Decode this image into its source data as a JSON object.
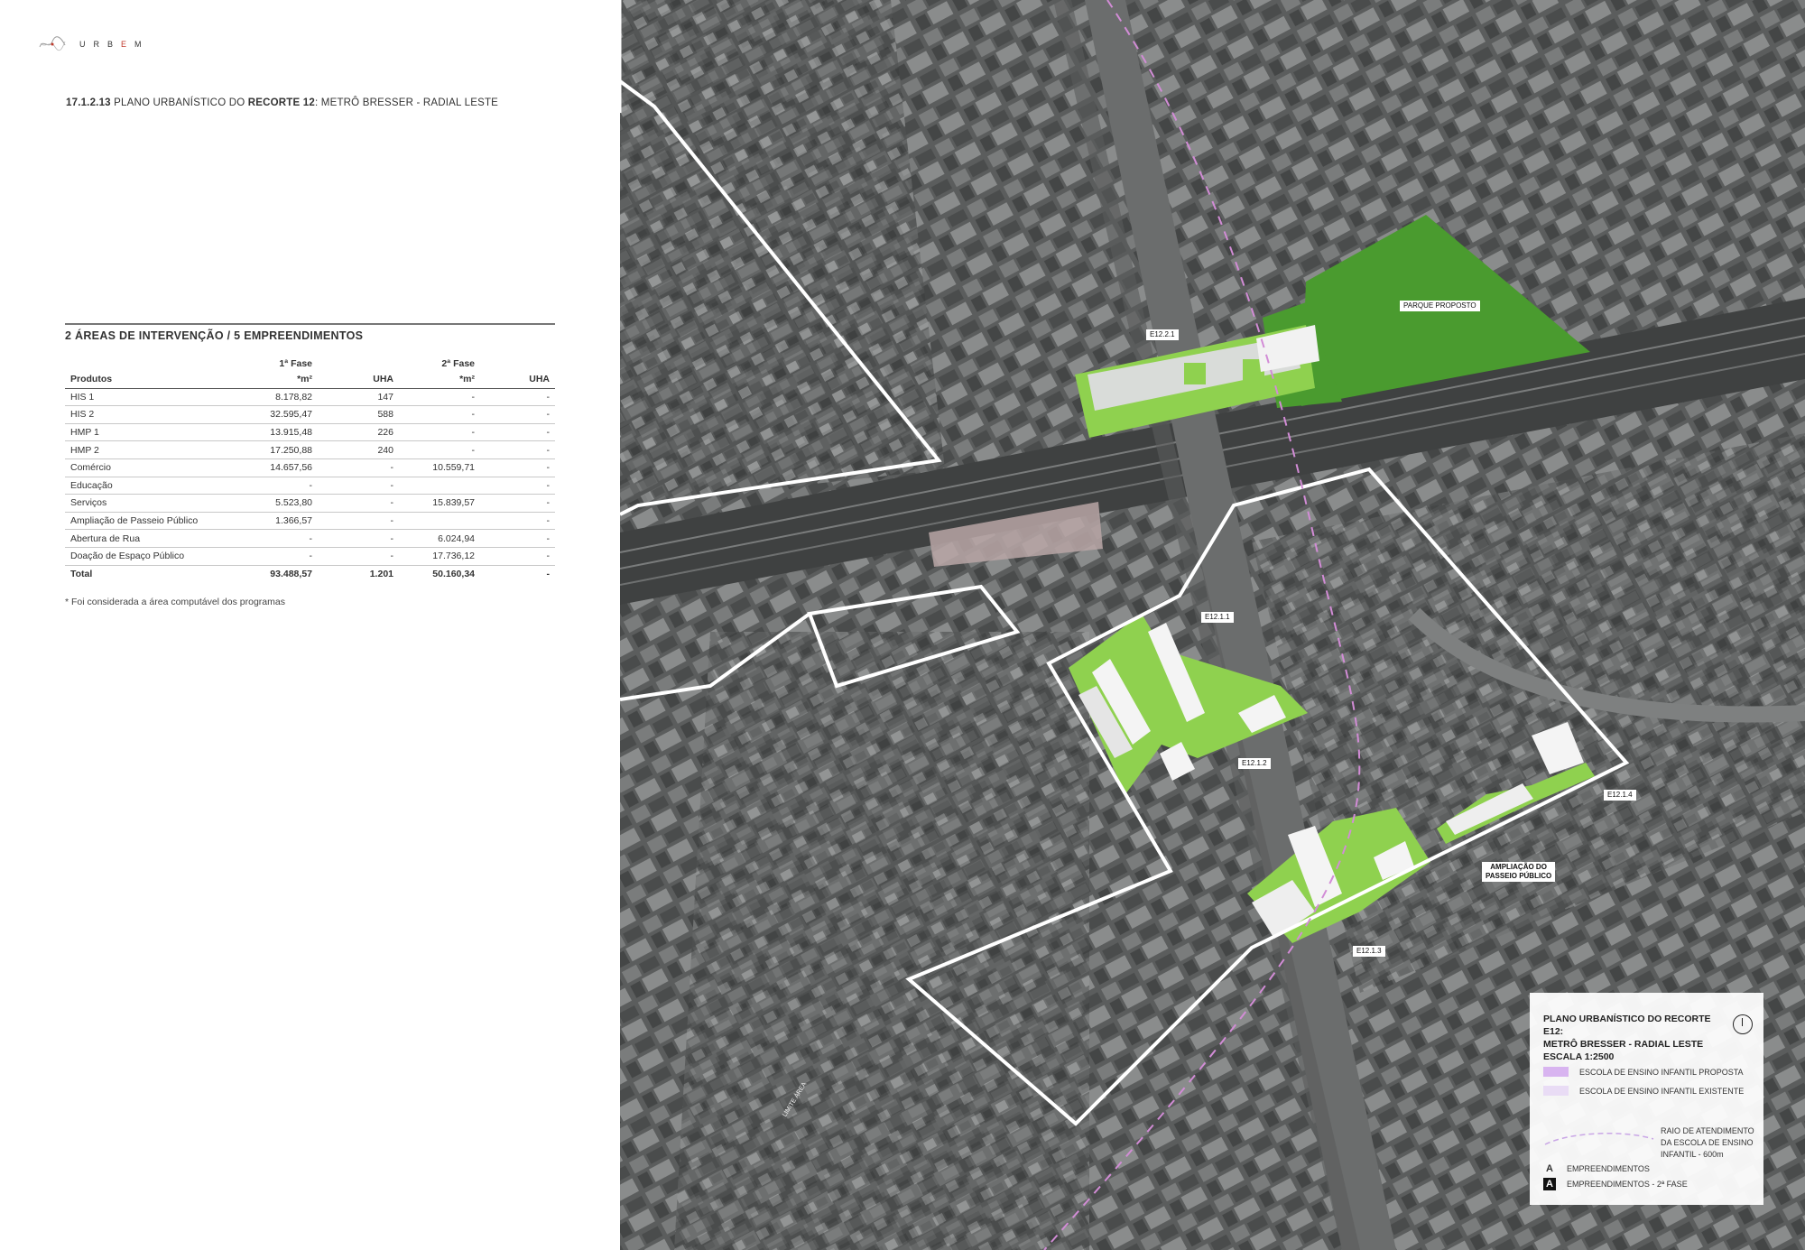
{
  "brand": {
    "logo_text_pre": "URB",
    "logo_text_hl": "E",
    "logo_text_post": "M"
  },
  "heading": {
    "number": "17.1.2.13",
    "text_a": " PLANO URBANÍSTICO DO ",
    "bold": "RECORTE 12",
    "text_b": ": METRÔ BRESSER - RADIAL LESTE"
  },
  "section": {
    "title": "2 ÁREAS DE INTERVENÇÃO / 5 EMPREENDIMENTOS"
  },
  "table": {
    "phase1": "1ª Fase",
    "phase2": "2ª Fase",
    "columns": [
      "Produtos",
      "*m²",
      "UHA",
      "*m²",
      "UHA"
    ],
    "rows": [
      [
        "HIS 1",
        "8.178,82",
        "147",
        "-",
        "-"
      ],
      [
        "HIS 2",
        "32.595,47",
        "588",
        "-",
        "-"
      ],
      [
        "HMP 1",
        "13.915,48",
        "226",
        "-",
        "-"
      ],
      [
        "HMP 2",
        "17.250,88",
        "240",
        "-",
        "-"
      ],
      [
        "Comércio",
        "14.657,56",
        "-",
        "10.559,71",
        "-"
      ],
      [
        "Educação",
        "-",
        "-",
        "",
        "-"
      ],
      [
        "Serviços",
        "5.523,80",
        "-",
        "15.839,57",
        "-"
      ],
      [
        "Ampliação de Passeio Público",
        "1.366,57",
        "-",
        "",
        "-"
      ],
      [
        "Abertura de Rua",
        "-",
        "-",
        "6.024,94",
        "-"
      ],
      [
        "Doação de Espaço Público",
        "-",
        "-",
        "17.736,12",
        "-"
      ]
    ],
    "total": [
      "Total",
      "93.488,57",
      "1.201",
      "50.160,34",
      "-"
    ]
  },
  "note": "* Foi considerada a área computável dos programas",
  "map": {
    "labels": {
      "parque": "PARQUE PROPOSTO",
      "e1221": "E12.2.1",
      "e1211": "E12.1.1",
      "e1212": "E12.1.2",
      "e1213": "E12.1.3",
      "e1214": "E12.1.4",
      "ampliacao_1": "AMPLIAÇÃO DO",
      "ampliacao_2": "PASSEIO PÚBLICO",
      "limite": "LIMITE ÁREA"
    },
    "colors": {
      "proposal_green": "#8fd14f",
      "park_green": "#4a9b2f",
      "boundary": "#ffffff",
      "school_radius": "#d28cd6"
    }
  },
  "legend": {
    "title_1": "PLANO URBANÍSTICO DO RECORTE E12:",
    "title_2": "METRÔ BRESSER - RADIAL LESTE",
    "scale": "ESCALA 1:2500",
    "escola_proposta": "ESCOLA DE ENSINO INFANTIL PROPOSTA",
    "escola_existente": "ESCOLA DE ENSINO INFANTIL EXISTENTE",
    "raio_1": "RAIO DE ATENDIMENTO",
    "raio_2": "DA ESCOLA DE ENSINO",
    "raio_3": "INFANTIL - 600m",
    "letter": "A",
    "empreendimentos": "EMPREENDIMENTOS",
    "empreendimentos_2": "EMPREENDIMENTOS - 2ª FASE",
    "colors": {
      "proposta": "#d8b4f0",
      "existente": "#e9dcf5"
    },
    "icons": [
      "north-arrow-icon"
    ]
  }
}
